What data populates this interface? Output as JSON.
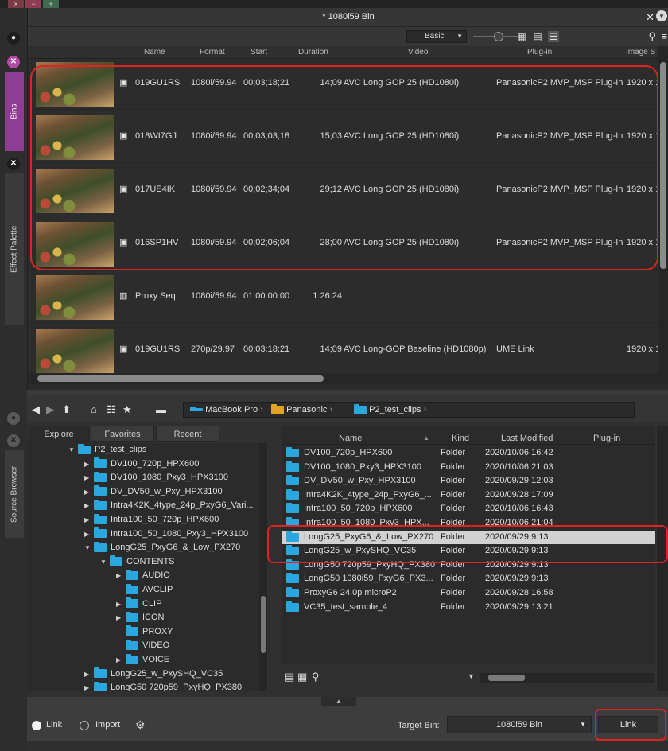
{
  "window": {
    "close_icon": "×",
    "minimize_icon": "−",
    "expand_icon": "+"
  },
  "left_tabs": {
    "bins_label": "Bins",
    "effect_palette_label": "Effect Palette",
    "source_browser_label": "Source Browser"
  },
  "bin": {
    "title": "* 1080i59 Bin",
    "view_mode": "Basic",
    "columns": [
      "Name",
      "Format",
      "Start",
      "Duration",
      "Video",
      "Plug-in",
      "Image S"
    ],
    "rows": [
      {
        "name": "019GU1RS",
        "format": "1080i/59.94",
        "start": "00;03;18;21",
        "duration": "14;09",
        "video": "AVC Long GOP 25 (HD1080i)",
        "plugin": "PanasonicP2 MVP_MSP Plug-In",
        "image_size": "1920 x 1"
      },
      {
        "name": "018WI7GJ",
        "format": "1080i/59.94",
        "start": "00;03;03;18",
        "duration": "15;03",
        "video": "AVC Long GOP 25 (HD1080i)",
        "plugin": "PanasonicP2 MVP_MSP Plug-In",
        "image_size": "1920 x 1"
      },
      {
        "name": "017UE4IK",
        "format": "1080i/59.94",
        "start": "00;02;34;04",
        "duration": "29;12",
        "video": "AVC Long GOP 25 (HD1080i)",
        "plugin": "PanasonicP2 MVP_MSP Plug-In",
        "image_size": "1920 x 1"
      },
      {
        "name": "016SP1HV",
        "format": "1080i/59.94",
        "start": "00;02;06;04",
        "duration": "28;00",
        "video": "AVC Long GOP 25 (HD1080i)",
        "plugin": "PanasonicP2 MVP_MSP Plug-In",
        "image_size": "1920 x 1"
      },
      {
        "name": "Proxy Seq",
        "format": "1080i/59.94",
        "start": "01:00:00:00",
        "duration": "1:26:24",
        "video": "",
        "plugin": "",
        "image_size": ""
      },
      {
        "name": "019GU1RS",
        "format": "270p/29.97",
        "start": "00;03;18;21",
        "duration": "14;09",
        "video": "AVC Long-GOP Baseline (HD1080p)",
        "plugin": "UME Link",
        "image_size": "1920 x 1"
      }
    ]
  },
  "source_browser": {
    "path": [
      "MacBook Pro",
      "Panasonic",
      "P2_test_clips"
    ],
    "tabs": [
      "Explore",
      "Favorites",
      "Recent"
    ],
    "tree": [
      {
        "label": "P2_test_clips",
        "depth": 0,
        "expanded": true
      },
      {
        "label": "DV100_720p_HPX600",
        "depth": 1,
        "expanded": false
      },
      {
        "label": "DV100_1080_Pxy3_HPX3100",
        "depth": 1,
        "expanded": false
      },
      {
        "label": "DV_DV50_w_Pxy_HPX3100",
        "depth": 1,
        "expanded": false
      },
      {
        "label": "Intra4K2K_4type_24p_PxyG6_Vari...",
        "depth": 1,
        "expanded": false
      },
      {
        "label": "Intra100_50_720p_HPX600",
        "depth": 1,
        "expanded": false
      },
      {
        "label": "Intra100_50_1080_Pxy3_HPX3100",
        "depth": 1,
        "expanded": false
      },
      {
        "label": "LongG25_PxyG6_&_Low_PX270",
        "depth": 1,
        "expanded": true
      },
      {
        "label": "CONTENTS",
        "depth": 2,
        "expanded": true
      },
      {
        "label": "AUDIO",
        "depth": 3,
        "expanded": false
      },
      {
        "label": "AVCLIP",
        "depth": 3,
        "expanded": null
      },
      {
        "label": "CLIP",
        "depth": 3,
        "expanded": false
      },
      {
        "label": "ICON",
        "depth": 3,
        "expanded": false
      },
      {
        "label": "PROXY",
        "depth": 3,
        "expanded": null
      },
      {
        "label": "VIDEO",
        "depth": 3,
        "expanded": null
      },
      {
        "label": "VOICE",
        "depth": 3,
        "expanded": false
      },
      {
        "label": "LongG25_w_PxySHQ_VC35",
        "depth": 1,
        "expanded": false
      },
      {
        "label": "LongG50 720p59_PxyHQ_PX380",
        "depth": 1,
        "expanded": false
      }
    ],
    "columns": [
      "Name",
      "Kind",
      "Last Modified",
      "Plug-in"
    ],
    "files": [
      {
        "name": "DV100_720p_HPX600",
        "kind": "Folder",
        "modified": "2020/10/06 16:42"
      },
      {
        "name": "DV100_1080_Pxy3_HPX3100",
        "kind": "Folder",
        "modified": "2020/10/06 21:03"
      },
      {
        "name": "DV_DV50_w_Pxy_HPX3100",
        "kind": "Folder",
        "modified": "2020/09/29 12:03"
      },
      {
        "name": "Intra4K2K_4type_24p_PxyG6_...",
        "kind": "Folder",
        "modified": "2020/09/28 17:09"
      },
      {
        "name": "Intra100_50_720p_HPX600",
        "kind": "Folder",
        "modified": "2020/10/06 16:43"
      },
      {
        "name": "Intra100_50_1080_Pxy3_HPX...",
        "kind": "Folder",
        "modified": "2020/10/06 21:04"
      },
      {
        "name": "LongG25_PxyG6_&_Low_PX270",
        "kind": "Folder",
        "modified": "2020/09/29 9:13"
      },
      {
        "name": "LongG25_w_PxySHQ_VC35",
        "kind": "Folder",
        "modified": "2020/09/29 9:13"
      },
      {
        "name": "LongG50 720p59_PxyHQ_PX380",
        "kind": "Folder",
        "modified": "2020/09/29 9:13"
      },
      {
        "name": "LongG50 1080i59_PxyG6_PX3...",
        "kind": "Folder",
        "modified": "2020/09/29 9:13"
      },
      {
        "name": "ProxyG6 24.0p microP2",
        "kind": "Folder",
        "modified": "2020/09/28 16:58"
      },
      {
        "name": "VC35_test_sample_4",
        "kind": "Folder",
        "modified": "2020/09/29 13:21"
      }
    ]
  },
  "bottom": {
    "link_radio_label": "Link",
    "import_radio_label": "Import",
    "target_bin_label": "Target Bin:",
    "target_bin_value": "1080i59 Bin",
    "link_button_label": "Link"
  },
  "colors": {
    "highlight_red": "#e0231f",
    "folder_blue": "#2aa7de",
    "folder_yellow": "#e1a228",
    "selection": "#d2d2d2"
  }
}
